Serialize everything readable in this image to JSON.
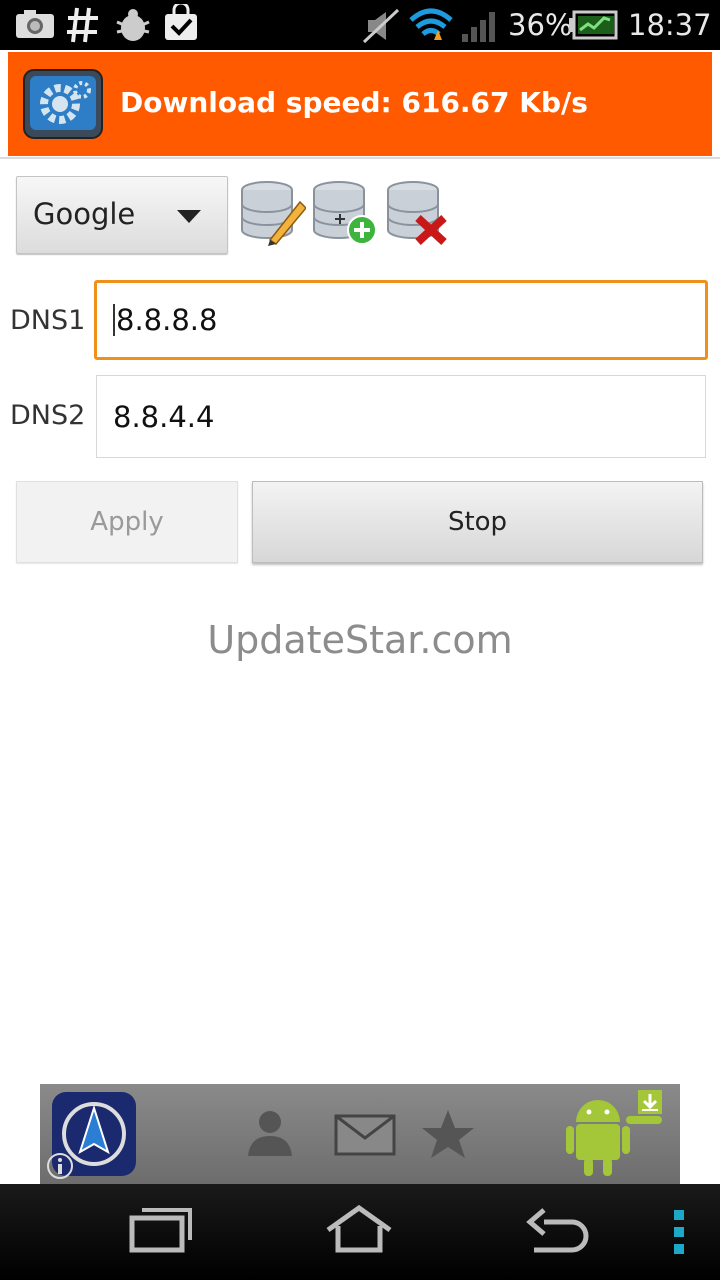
{
  "status_bar": {
    "battery": "36%",
    "time": "18:37",
    "icons": [
      "screenshot-icon",
      "hash-icon",
      "bug-icon",
      "shopping-bag-check-icon",
      "mute-icon",
      "wifi-icon",
      "signal-icon",
      "battery-icon",
      "chart-icon"
    ]
  },
  "header": {
    "title": "Download speed: 616.67 Kb/s",
    "icon": "gear-settings-icon",
    "color": "#ff5a00"
  },
  "provider": {
    "selected": "Google",
    "actions": [
      "edit-database-icon",
      "add-database-icon",
      "delete-database-icon"
    ]
  },
  "dns": {
    "dns1_label": "DNS1",
    "dns1_value": "8.8.8.8",
    "dns2_label": "DNS2",
    "dns2_value": "8.8.4.4"
  },
  "buttons": {
    "apply": "Apply",
    "stop": "Stop"
  },
  "watermark": "UpdateStar.com",
  "ad": {
    "icons": [
      "compass-app-icon",
      "info-icon",
      "person-icon",
      "mail-icon",
      "star-icon",
      "android-download-icon"
    ]
  },
  "nav": {
    "icons": [
      "recent-apps-icon",
      "home-icon",
      "back-icon",
      "menu-icon"
    ]
  }
}
